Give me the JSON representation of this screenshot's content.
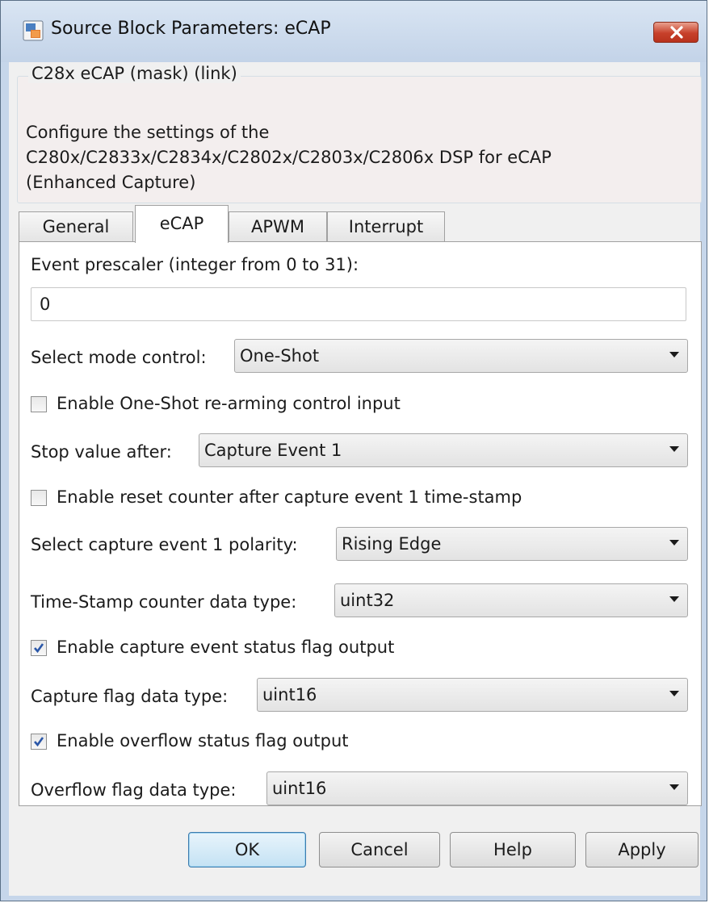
{
  "window": {
    "title": "Source Block Parameters: eCAP",
    "close_icon": "close-x-icon",
    "app_icon": "simulink-block-icon"
  },
  "description": {
    "group_title": "C28x eCAP (mask) (link)",
    "lines": [
      "Configure the settings of the",
      "C280x/C2833x/C2834x/C2802x/C2803x/C2806x DSP for eCAP",
      "(Enhanced Capture)"
    ]
  },
  "tabs": [
    {
      "label": "General",
      "active": false
    },
    {
      "label": "eCAP",
      "active": true
    },
    {
      "label": "APWM",
      "active": false
    },
    {
      "label": "Interrupt",
      "active": false
    }
  ],
  "form": {
    "event_prescaler_label": "Event prescaler (integer from 0 to 31):",
    "event_prescaler_value": "0",
    "mode_control_label": "Select mode control:",
    "mode_control_value": "One-Shot",
    "rearm_label": "Enable One-Shot re-arming control input",
    "rearm_checked": false,
    "stop_value_label": "Stop value after:",
    "stop_value_value": "Capture Event 1",
    "reset_counter_label": "Enable reset counter after capture event 1 time-stamp",
    "reset_counter_checked": false,
    "polarity_label": "Select capture event 1 polarity:",
    "polarity_value": "Rising Edge",
    "timestamp_type_label": "Time-Stamp counter data type:",
    "timestamp_type_value": "uint32",
    "status_flag_label": "Enable capture event status flag output",
    "status_flag_checked": true,
    "capture_flag_type_label": "Capture flag data type:",
    "capture_flag_type_value": "uint16",
    "overflow_flag_label": "Enable overflow status flag output",
    "overflow_flag_checked": true,
    "overflow_flag_type_label": "Overflow flag data type:",
    "overflow_flag_type_value": "uint16"
  },
  "buttons": {
    "ok": "OK",
    "cancel": "Cancel",
    "help": "Help",
    "apply": "Apply"
  },
  "colors": {
    "window_frame": "#c6d6ea",
    "default_button": "#c4e2f4",
    "close_button": "#c7402a",
    "checkmark": "#2b57a8"
  }
}
